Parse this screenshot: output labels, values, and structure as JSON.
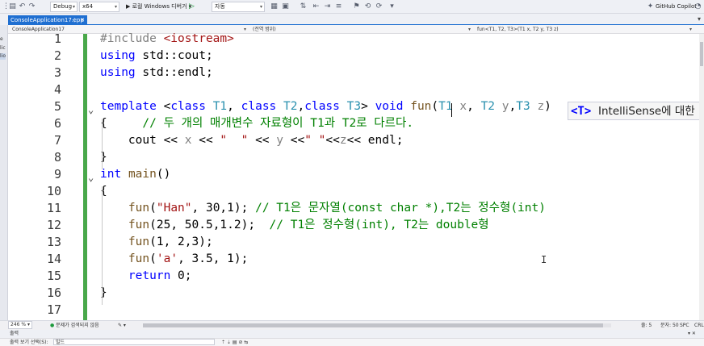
{
  "toolbar": {
    "config": "Debug",
    "platform": "x64",
    "run_label": "▶ 로컬 Windows 디버거 ▾",
    "auto_label": "자동",
    "copilot": "GitHub Copilot"
  },
  "tabs": [
    {
      "label": "ConsoleApplication17.cpp",
      "active": true
    }
  ],
  "navbar": {
    "project": "ConsoleApplication17",
    "scope": "(전역 범위)",
    "member": "fun<T1, T2, T3>(T1 x, T2 y, T3 z)"
  },
  "left_strip": {
    "items": [
      "e",
      "lic",
      "lio"
    ]
  },
  "code": {
    "line_numbers": [
      "1",
      "2",
      "3",
      "4",
      "5",
      "6",
      "7",
      "8",
      "9",
      "10",
      "11",
      "12",
      "13",
      "14",
      "15",
      "16",
      "17"
    ],
    "lines": [
      "#include <iostream>",
      "using std::cout;",
      "using std::endl;",
      "",
      "template <class T1, class T2,class T3> void fun(T1 x, T2 y,T3 z)",
      "{     // 두 개의 매개변수 자료형이 T1과 T2로 다르다.",
      "    cout << x << \"  \" << y <<\" \"<<z<< endl;",
      "}",
      "int main()",
      "{",
      "    fun(\"Han\", 30,1); // T1은 문자열(const char *),T2는 정수형(int)",
      "    fun(25, 50.5,1.2);  // T1은 정수형(int), T2는 double형",
      "    fun(1, 2,3);",
      "    fun('a', 3.5, 1);",
      "    return 0;",
      "}",
      ""
    ]
  },
  "tooltip": {
    "tag": "<T>",
    "text": "IntelliSense에 대한"
  },
  "status": {
    "zoom": "246 %",
    "issues": "문제가 검색되지 않음",
    "line": "줄: 5",
    "col": "문자: 50",
    "spc": "SPC",
    "crlf": "CRL"
  },
  "output_panel": {
    "title": "출력",
    "source_label": "출력 보기 선택(S):",
    "source_value": "빌드"
  },
  "colors": {
    "accent": "#1f6fd1",
    "change_bar": "#49a84a",
    "keyword": "#0000ff",
    "comment": "#008000",
    "string": "#a31515",
    "type_param": "#2b91af"
  }
}
